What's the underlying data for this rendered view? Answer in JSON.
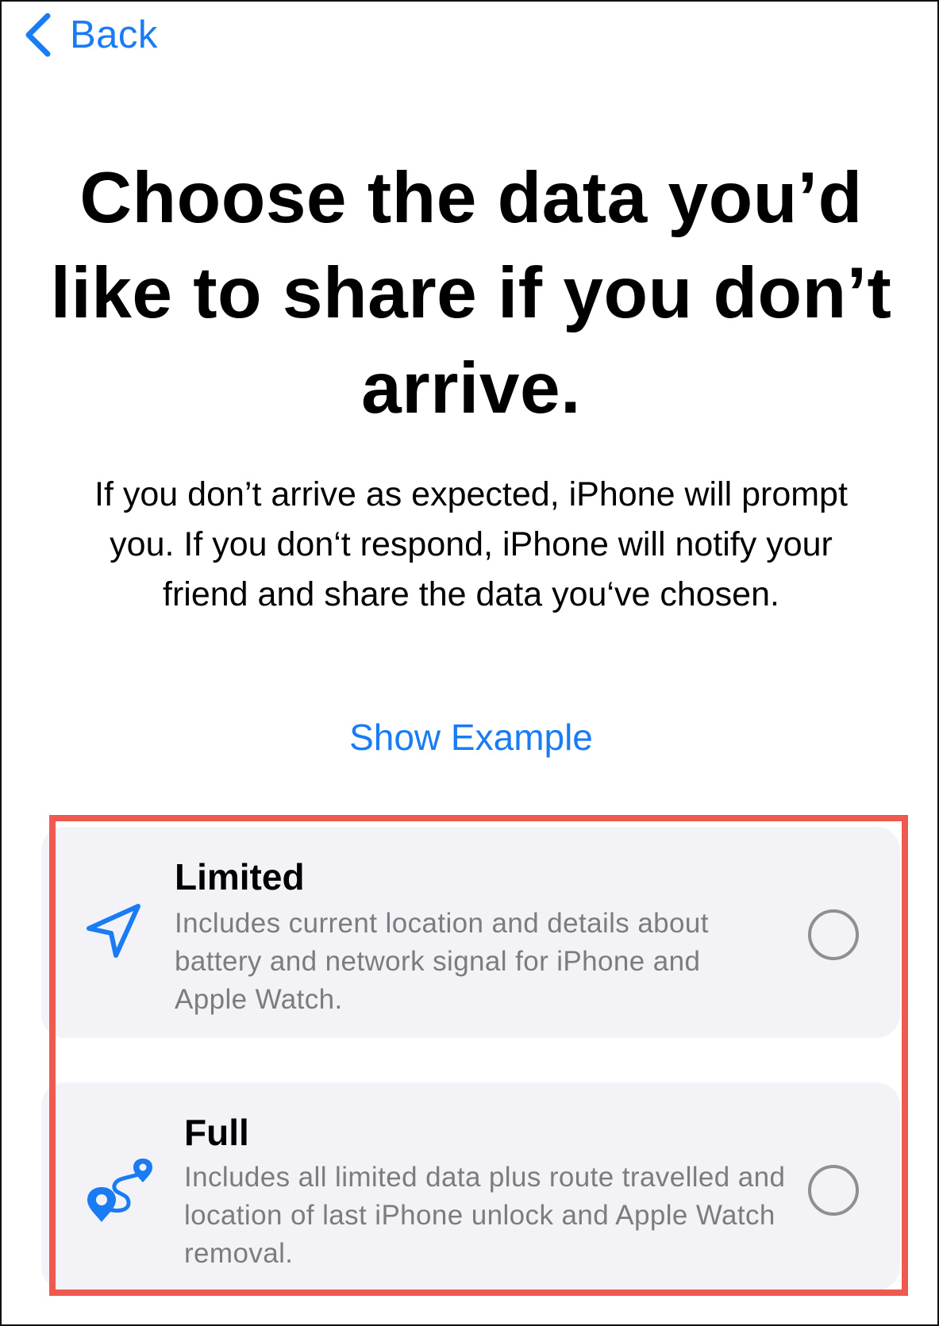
{
  "nav": {
    "back_label": "Back"
  },
  "title": "Choose the data you’d like to share if you don’t arrive.",
  "description": "If you don’t arrive as expected, iPhone will prompt you. If you don‘t respond, iPhone will notify your friend and share the data you‘ve chosen.",
  "show_example_label": "Show Example",
  "options": [
    {
      "title": "Limited",
      "description": "Includes current location and details about battery and network signal for iPhone and Apple Watch.",
      "icon": "location-arrow-icon",
      "selected": false
    },
    {
      "title": "Full",
      "description": "Includes all limited data plus route travelled and location of last iPhone unlock and Apple Watch removal.",
      "icon": "route-icon",
      "selected": false
    }
  ],
  "colors": {
    "accent": "#1a7cf5",
    "card_bg": "#f2f2f7",
    "secondary_text": "#7c7c80",
    "highlight_border": "#f0594f"
  }
}
